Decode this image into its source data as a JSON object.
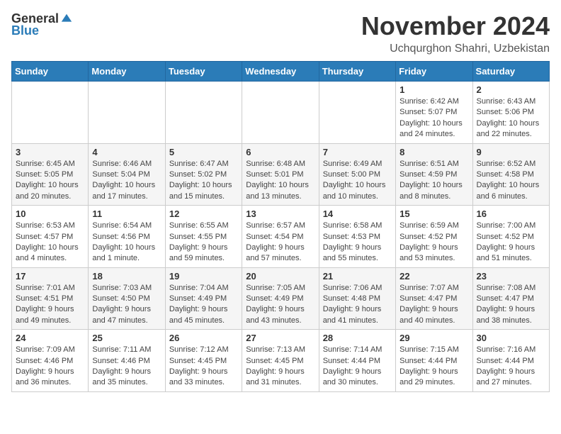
{
  "header": {
    "logo_general": "General",
    "logo_blue": "Blue",
    "month_title": "November 2024",
    "location": "Uchqurghon Shahri, Uzbekistan"
  },
  "calendar": {
    "columns": [
      "Sunday",
      "Monday",
      "Tuesday",
      "Wednesday",
      "Thursday",
      "Friday",
      "Saturday"
    ],
    "weeks": [
      [
        {
          "day": "",
          "info": ""
        },
        {
          "day": "",
          "info": ""
        },
        {
          "day": "",
          "info": ""
        },
        {
          "day": "",
          "info": ""
        },
        {
          "day": "",
          "info": ""
        },
        {
          "day": "1",
          "info": "Sunrise: 6:42 AM\nSunset: 5:07 PM\nDaylight: 10 hours and 24 minutes."
        },
        {
          "day": "2",
          "info": "Sunrise: 6:43 AM\nSunset: 5:06 PM\nDaylight: 10 hours and 22 minutes."
        }
      ],
      [
        {
          "day": "3",
          "info": "Sunrise: 6:45 AM\nSunset: 5:05 PM\nDaylight: 10 hours and 20 minutes."
        },
        {
          "day": "4",
          "info": "Sunrise: 6:46 AM\nSunset: 5:04 PM\nDaylight: 10 hours and 17 minutes."
        },
        {
          "day": "5",
          "info": "Sunrise: 6:47 AM\nSunset: 5:02 PM\nDaylight: 10 hours and 15 minutes."
        },
        {
          "day": "6",
          "info": "Sunrise: 6:48 AM\nSunset: 5:01 PM\nDaylight: 10 hours and 13 minutes."
        },
        {
          "day": "7",
          "info": "Sunrise: 6:49 AM\nSunset: 5:00 PM\nDaylight: 10 hours and 10 minutes."
        },
        {
          "day": "8",
          "info": "Sunrise: 6:51 AM\nSunset: 4:59 PM\nDaylight: 10 hours and 8 minutes."
        },
        {
          "day": "9",
          "info": "Sunrise: 6:52 AM\nSunset: 4:58 PM\nDaylight: 10 hours and 6 minutes."
        }
      ],
      [
        {
          "day": "10",
          "info": "Sunrise: 6:53 AM\nSunset: 4:57 PM\nDaylight: 10 hours and 4 minutes."
        },
        {
          "day": "11",
          "info": "Sunrise: 6:54 AM\nSunset: 4:56 PM\nDaylight: 10 hours and 1 minute."
        },
        {
          "day": "12",
          "info": "Sunrise: 6:55 AM\nSunset: 4:55 PM\nDaylight: 9 hours and 59 minutes."
        },
        {
          "day": "13",
          "info": "Sunrise: 6:57 AM\nSunset: 4:54 PM\nDaylight: 9 hours and 57 minutes."
        },
        {
          "day": "14",
          "info": "Sunrise: 6:58 AM\nSunset: 4:53 PM\nDaylight: 9 hours and 55 minutes."
        },
        {
          "day": "15",
          "info": "Sunrise: 6:59 AM\nSunset: 4:52 PM\nDaylight: 9 hours and 53 minutes."
        },
        {
          "day": "16",
          "info": "Sunrise: 7:00 AM\nSunset: 4:52 PM\nDaylight: 9 hours and 51 minutes."
        }
      ],
      [
        {
          "day": "17",
          "info": "Sunrise: 7:01 AM\nSunset: 4:51 PM\nDaylight: 9 hours and 49 minutes."
        },
        {
          "day": "18",
          "info": "Sunrise: 7:03 AM\nSunset: 4:50 PM\nDaylight: 9 hours and 47 minutes."
        },
        {
          "day": "19",
          "info": "Sunrise: 7:04 AM\nSunset: 4:49 PM\nDaylight: 9 hours and 45 minutes."
        },
        {
          "day": "20",
          "info": "Sunrise: 7:05 AM\nSunset: 4:49 PM\nDaylight: 9 hours and 43 minutes."
        },
        {
          "day": "21",
          "info": "Sunrise: 7:06 AM\nSunset: 4:48 PM\nDaylight: 9 hours and 41 minutes."
        },
        {
          "day": "22",
          "info": "Sunrise: 7:07 AM\nSunset: 4:47 PM\nDaylight: 9 hours and 40 minutes."
        },
        {
          "day": "23",
          "info": "Sunrise: 7:08 AM\nSunset: 4:47 PM\nDaylight: 9 hours and 38 minutes."
        }
      ],
      [
        {
          "day": "24",
          "info": "Sunrise: 7:09 AM\nSunset: 4:46 PM\nDaylight: 9 hours and 36 minutes."
        },
        {
          "day": "25",
          "info": "Sunrise: 7:11 AM\nSunset: 4:46 PM\nDaylight: 9 hours and 35 minutes."
        },
        {
          "day": "26",
          "info": "Sunrise: 7:12 AM\nSunset: 4:45 PM\nDaylight: 9 hours and 33 minutes."
        },
        {
          "day": "27",
          "info": "Sunrise: 7:13 AM\nSunset: 4:45 PM\nDaylight: 9 hours and 31 minutes."
        },
        {
          "day": "28",
          "info": "Sunrise: 7:14 AM\nSunset: 4:44 PM\nDaylight: 9 hours and 30 minutes."
        },
        {
          "day": "29",
          "info": "Sunrise: 7:15 AM\nSunset: 4:44 PM\nDaylight: 9 hours and 29 minutes."
        },
        {
          "day": "30",
          "info": "Sunrise: 7:16 AM\nSunset: 4:44 PM\nDaylight: 9 hours and 27 minutes."
        }
      ]
    ]
  }
}
